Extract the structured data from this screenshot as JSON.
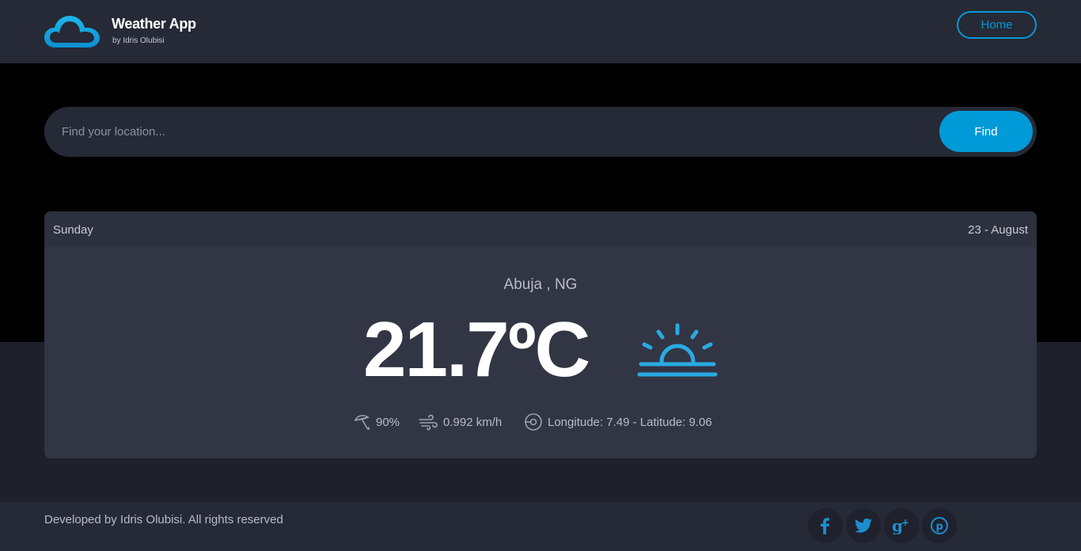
{
  "header": {
    "title": "Weather App",
    "subtitle": "by Idris Olubisi",
    "home_label": "Home",
    "logo_icon": "cloud-icon"
  },
  "search": {
    "placeholder": "Find your location...",
    "value": "",
    "button_label": "Find"
  },
  "forecast": {
    "day": "Sunday",
    "date": "23 - August",
    "location": "Abuja , NG",
    "temperature": "21.7ºC",
    "condition_icon": "sunrise-icon",
    "humidity": "90%",
    "wind": "0.992 km/h",
    "coordinates": "Longitude: 7.49 - Latitude: 9.06"
  },
  "footer": {
    "copyright": "Developed by Idris Olubisi. All rights reserved",
    "social": [
      "facebook-icon",
      "twitter-icon",
      "google-plus-icon",
      "pinterest-icon"
    ]
  },
  "colors": {
    "accent": "#009ad8",
    "header_bg": "#262936",
    "card_bg": "#323544",
    "page_bg": "#000000"
  }
}
